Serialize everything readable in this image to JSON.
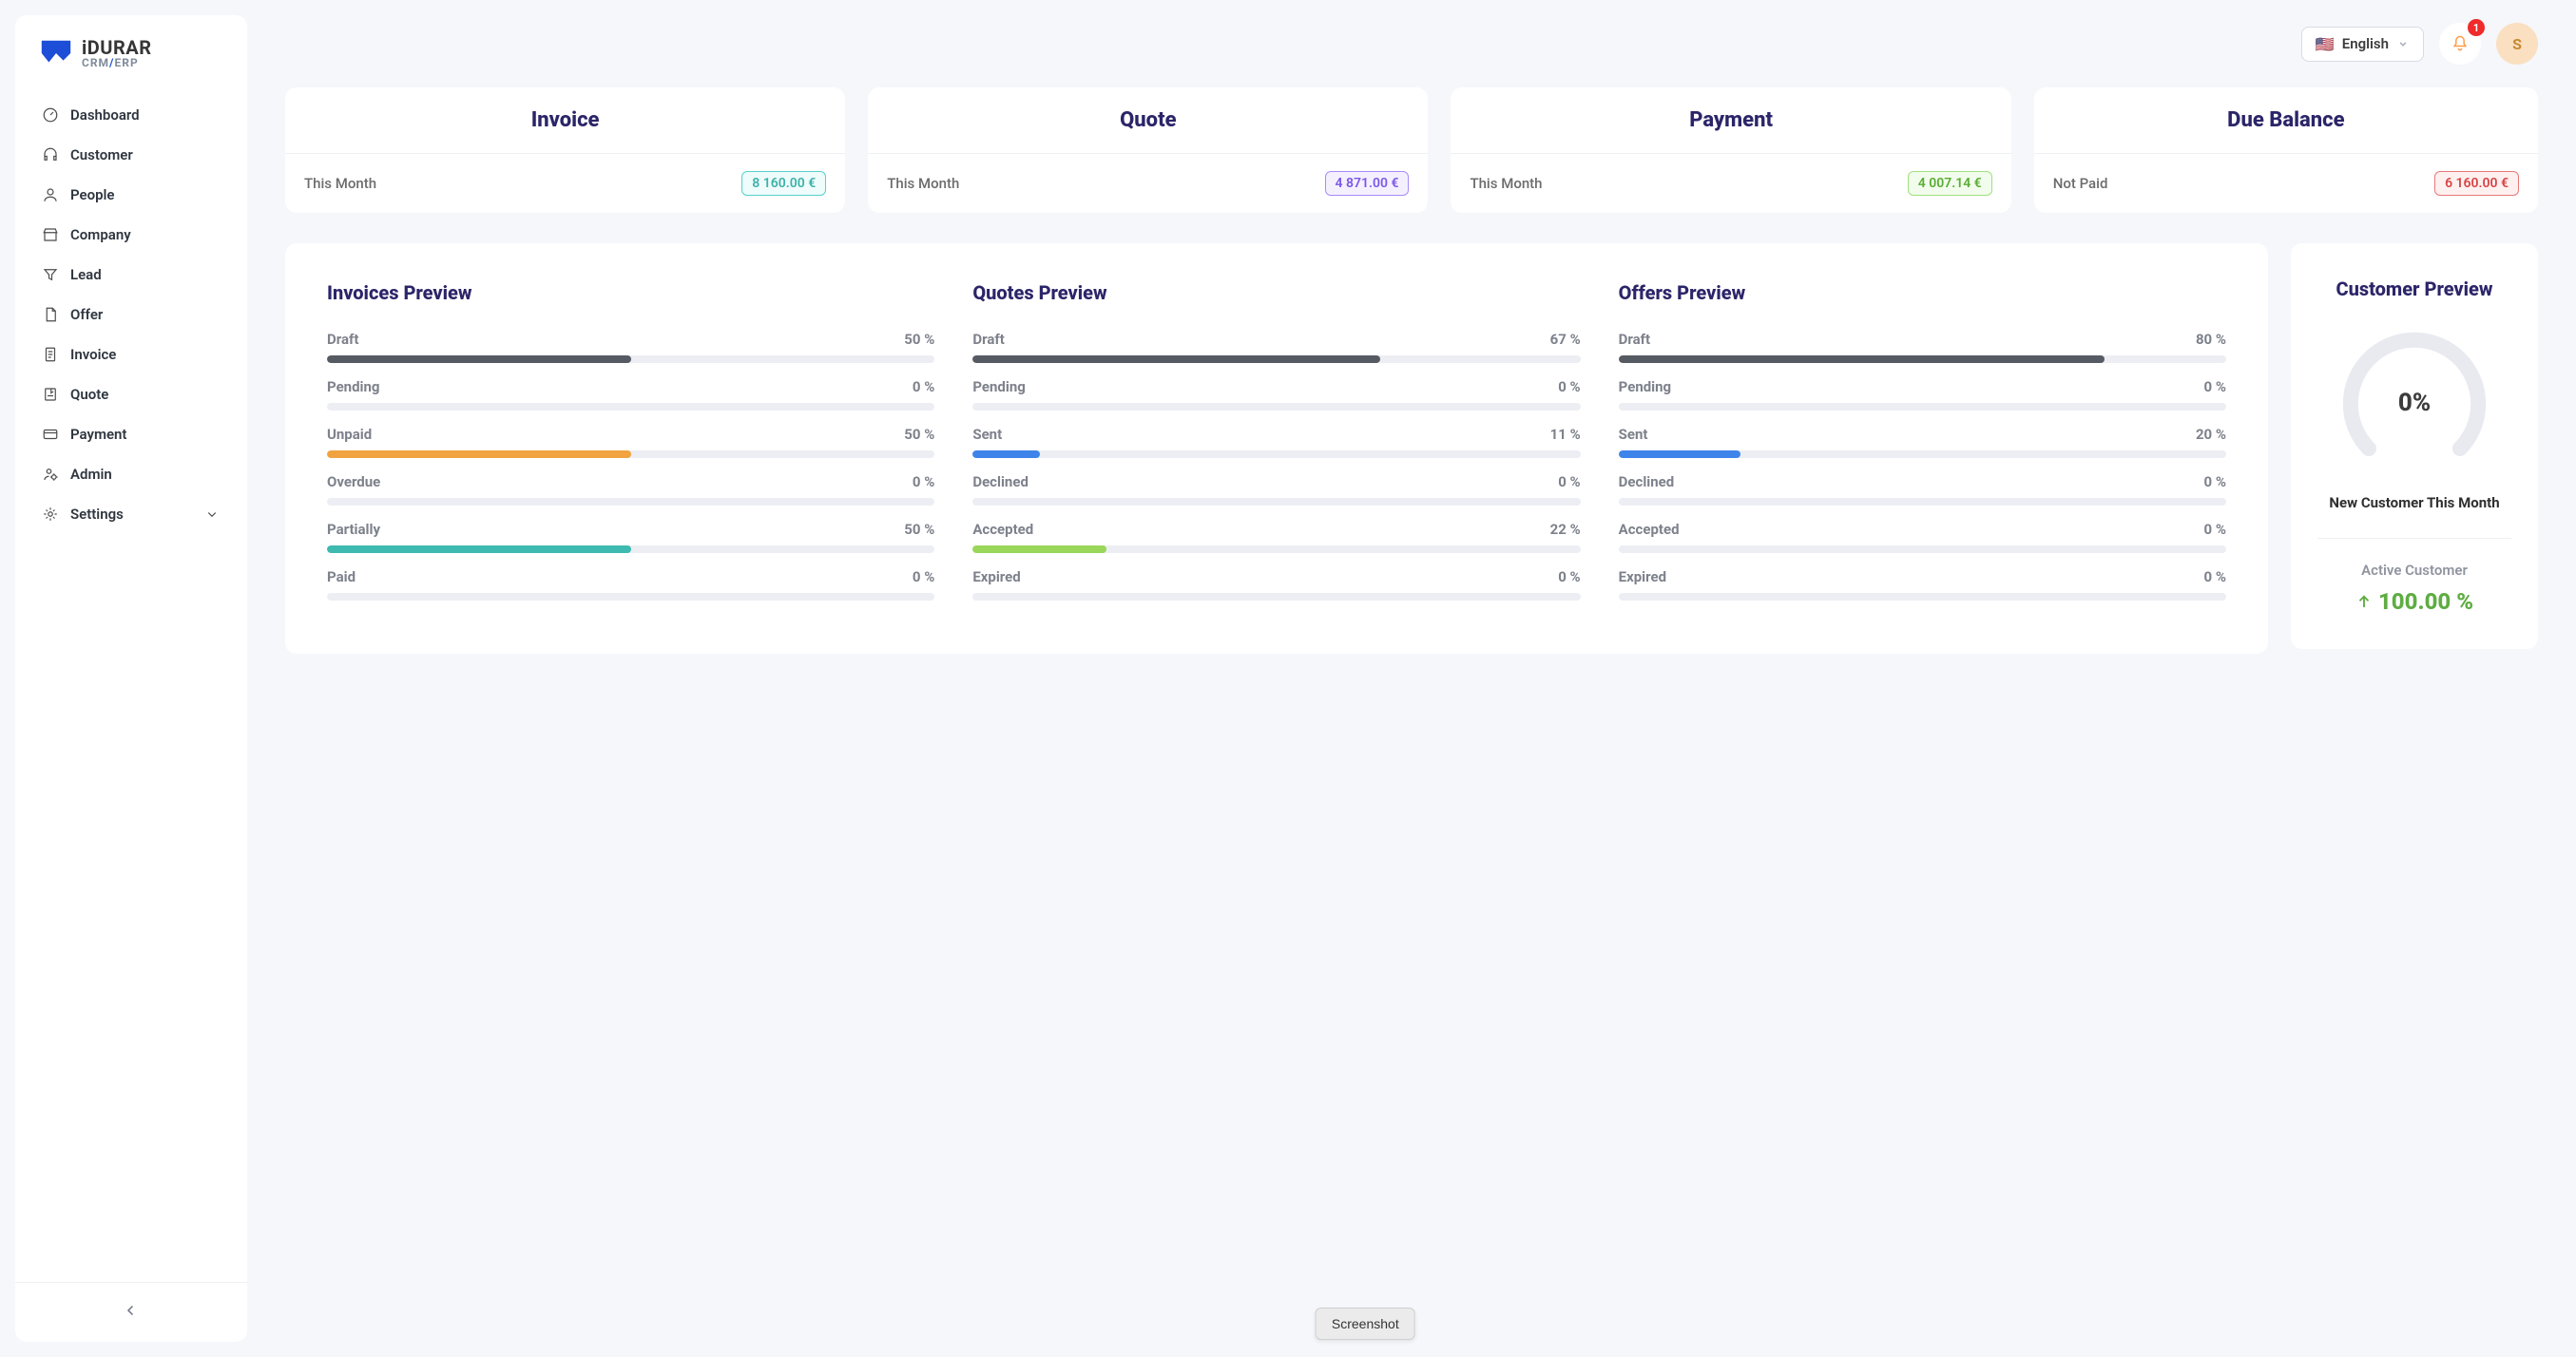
{
  "brand": {
    "name": "iDURAR",
    "sub": "CRM/ERP"
  },
  "sidebar": {
    "items": [
      {
        "label": "Dashboard"
      },
      {
        "label": "Customer"
      },
      {
        "label": "People"
      },
      {
        "label": "Company"
      },
      {
        "label": "Lead"
      },
      {
        "label": "Offer"
      },
      {
        "label": "Invoice"
      },
      {
        "label": "Quote"
      },
      {
        "label": "Payment"
      },
      {
        "label": "Admin"
      },
      {
        "label": "Settings"
      }
    ]
  },
  "header": {
    "language": "English",
    "notification_count": "1",
    "avatar_letter": "S"
  },
  "stats": {
    "invoice": {
      "title": "Invoice",
      "period": "This Month",
      "amount": "8 160.00 €",
      "chip": "chip-teal"
    },
    "quote": {
      "title": "Quote",
      "period": "This Month",
      "amount": "4 871.00 €",
      "chip": "chip-purple"
    },
    "payment": {
      "title": "Payment",
      "period": "This Month",
      "amount": "4 007.14 €",
      "chip": "chip-green"
    },
    "due": {
      "title": "Due Balance",
      "period": "Not Paid",
      "amount": "6 160.00 €",
      "chip": "chip-red"
    }
  },
  "previews": {
    "invoices": {
      "title": "Invoices Preview",
      "rows": [
        {
          "label": "Draft",
          "pct": "50 %",
          "width": 50,
          "color": "#565a63"
        },
        {
          "label": "Pending",
          "pct": "0 %",
          "width": 0,
          "color": "#b685f1"
        },
        {
          "label": "Unpaid",
          "pct": "50 %",
          "width": 50,
          "color": "#f0a33f"
        },
        {
          "label": "Overdue",
          "pct": "0 %",
          "width": 0,
          "color": "#e05656"
        },
        {
          "label": "Partially",
          "pct": "50 %",
          "width": 50,
          "color": "#3ebab0"
        },
        {
          "label": "Paid",
          "pct": "0 %",
          "width": 0,
          "color": "#76c758"
        }
      ]
    },
    "quotes": {
      "title": "Quotes Preview",
      "rows": [
        {
          "label": "Draft",
          "pct": "67 %",
          "width": 67,
          "color": "#565a63"
        },
        {
          "label": "Pending",
          "pct": "0 %",
          "width": 0,
          "color": "#b685f1"
        },
        {
          "label": "Sent",
          "pct": "11 %",
          "width": 11,
          "color": "#3e84ea"
        },
        {
          "label": "Declined",
          "pct": "0 %",
          "width": 0,
          "color": "#e05656"
        },
        {
          "label": "Accepted",
          "pct": "22 %",
          "width": 22,
          "color": "#9ad659"
        },
        {
          "label": "Expired",
          "pct": "0 %",
          "width": 0,
          "color": "#bcbcbc"
        }
      ]
    },
    "offers": {
      "title": "Offers Preview",
      "rows": [
        {
          "label": "Draft",
          "pct": "80 %",
          "width": 80,
          "color": "#565a63"
        },
        {
          "label": "Pending",
          "pct": "0 %",
          "width": 0,
          "color": "#b685f1"
        },
        {
          "label": "Sent",
          "pct": "20 %",
          "width": 20,
          "color": "#3e84ea"
        },
        {
          "label": "Declined",
          "pct": "0 %",
          "width": 0,
          "color": "#e05656"
        },
        {
          "label": "Accepted",
          "pct": "0 %",
          "width": 0,
          "color": "#9ad659"
        },
        {
          "label": "Expired",
          "pct": "0 %",
          "width": 0,
          "color": "#bcbcbc"
        }
      ]
    }
  },
  "customer": {
    "title": "Customer Preview",
    "gauge_pct": "0%",
    "sub": "New Customer This Month",
    "active_label": "Active Customer",
    "active_value": "100.00 %"
  },
  "screenshot_label": "Screenshot"
}
